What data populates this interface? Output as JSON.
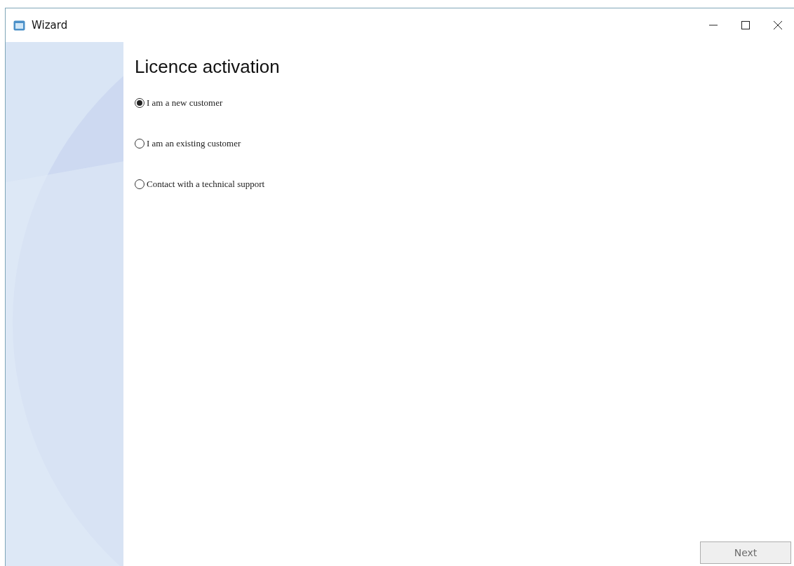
{
  "window": {
    "title": "Wizard"
  },
  "page": {
    "heading": "Licence activation"
  },
  "options": [
    {
      "label": "I am a new customer",
      "selected": true
    },
    {
      "label": "I am an existing customer",
      "selected": false
    },
    {
      "label": "Contact with a technical support",
      "selected": false
    }
  ],
  "buttons": [
    {
      "label": "Next",
      "disabled": true
    }
  ]
}
